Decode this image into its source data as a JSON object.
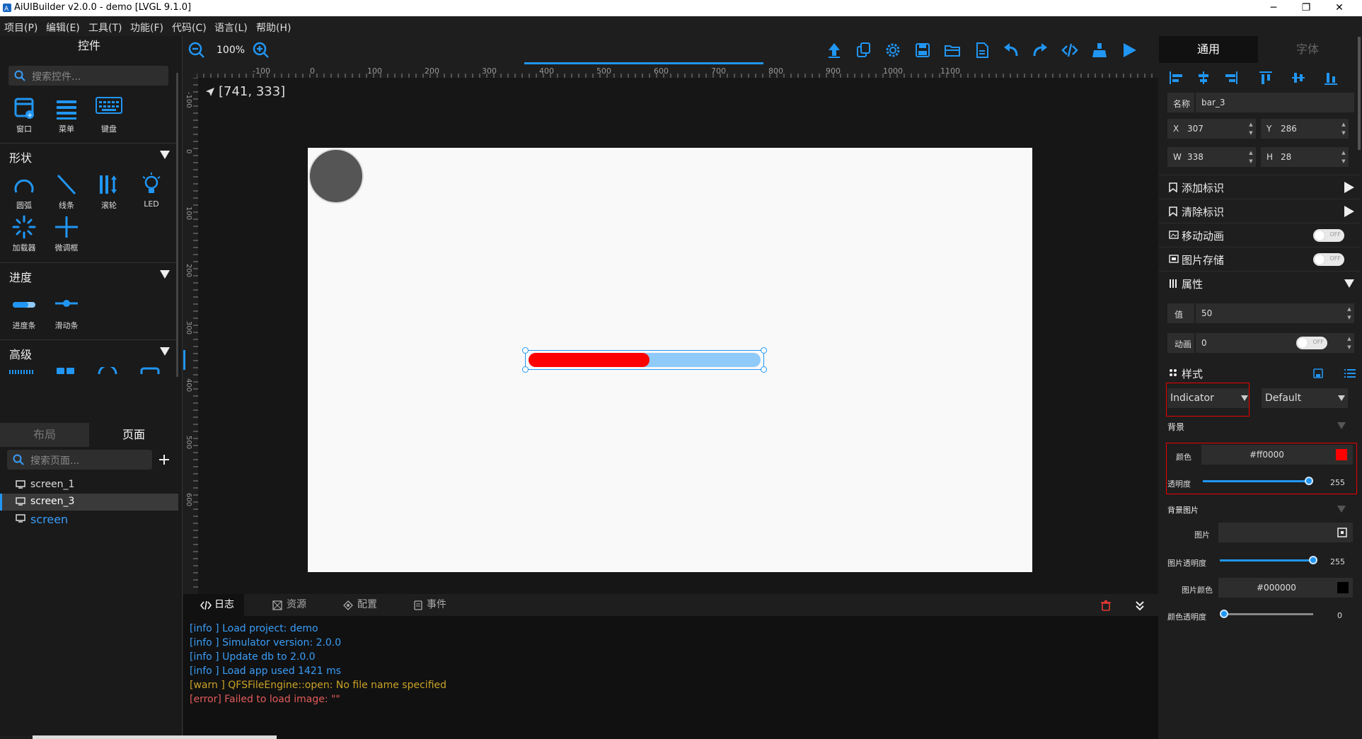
{
  "window": {
    "title": "AiUIBuilder v2.0.0 - demo [LVGL 9.1.0]",
    "minimize": "─",
    "maximize": "❐",
    "close": "✕"
  },
  "menu": [
    "项目(P)",
    "编辑(E)",
    "工具(T)",
    "功能(F)",
    "代码(C)",
    "语言(L)",
    "帮助(H)"
  ],
  "left_panel": {
    "title": "控件",
    "search_placeholder": "搜索控件...",
    "basic": [
      "窗口",
      "菜单",
      "键盘"
    ],
    "shape_section": "形状",
    "shape_items": [
      "圆弧",
      "线条",
      "滚轮",
      "LED",
      "加载器",
      "微调框"
    ],
    "progress_section": "进度",
    "progress_items": [
      "进度条",
      "滑动条"
    ],
    "advanced_section": "高级",
    "tabs": [
      "布局",
      "页面"
    ],
    "page_search_placeholder": "搜索页面...",
    "pages": [
      "screen_1",
      "screen_3",
      "screen"
    ]
  },
  "toolbar": {
    "zoom": "100%"
  },
  "ruler": {
    "h_labels": [
      "-100",
      "0",
      "100",
      "200",
      "300",
      "400",
      "500",
      "600",
      "700",
      "800",
      "900",
      "1000",
      "1100"
    ],
    "v_labels": [
      "-100",
      "0",
      "100",
      "200",
      "300",
      "400",
      "500",
      "600"
    ]
  },
  "canvas": {
    "coord": "[741, 333]",
    "bar_value": 50,
    "bar_indicator_color": "#ff0000",
    "bar_bg_color": "#90caf9"
  },
  "bottom_panel": {
    "tabs": [
      "日志",
      "资源",
      "配置",
      "事件"
    ],
    "logs": [
      {
        "text": "[info ] Load project: demo",
        "level": "info"
      },
      {
        "text": "[info ] Simulator version: 2.0.0",
        "level": "info"
      },
      {
        "text": "[info ] Update db to 2.0.0",
        "level": "info"
      },
      {
        "text": "[info ] Load app used 1421 ms",
        "level": "info"
      },
      {
        "text": "[warn ] QFSFileEngine::open: No file name specified",
        "level": "warn"
      },
      {
        "text": "[error] Failed to load image: \"\"",
        "level": "error"
      }
    ]
  },
  "right_panel": {
    "tabs": [
      "通用",
      "字体"
    ],
    "name_label": "名称",
    "name_value": "bar_3",
    "x_label": "X",
    "x_value": "307",
    "y_label": "Y",
    "y_value": "286",
    "w_label": "W",
    "w_value": "338",
    "h_label": "H",
    "h_value": "28",
    "add_flag": "添加标识",
    "clear_flag": "清除标识",
    "move_anim": "移动动画",
    "image_cache": "图片存储",
    "toggle_off": "OFF",
    "props": "属性",
    "value_label": "值",
    "value": "50",
    "anim_label": "动画",
    "anim_value": "0",
    "style": "样式",
    "part_select": "Indicator",
    "state_select": "Default",
    "bg_section": "背景",
    "color_label": "颜色",
    "color_value": "#ff0000",
    "opacity_label": "透明度",
    "opacity_value": "255",
    "bg_img_section": "背景图片",
    "img_label": "图片",
    "img_opacity_label": "图片透明度",
    "img_opacity_value": "255",
    "img_color_label": "图片颜色",
    "img_color_value": "#000000",
    "color_opacity_label": "颜色透明度",
    "color_opacity_value": "0"
  }
}
